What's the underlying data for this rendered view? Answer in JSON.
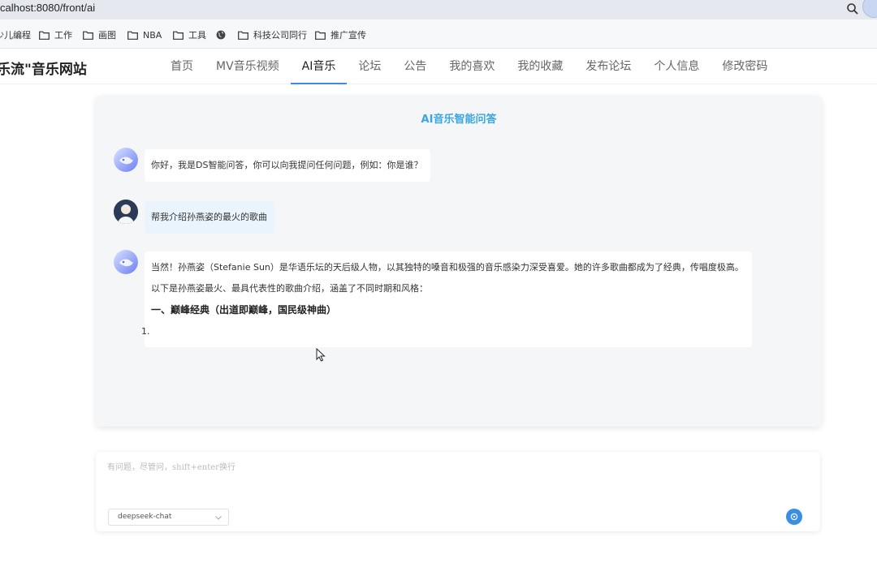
{
  "browser": {
    "url": "calhost:8080/front/ai",
    "bookmarks": [
      {
        "label": "少儿编程",
        "icon": "folder-icon"
      },
      {
        "label": "工作",
        "icon": "folder-icon"
      },
      {
        "label": "画图",
        "icon": "folder-icon"
      },
      {
        "label": "NBA",
        "icon": "folder-icon"
      },
      {
        "label": "工具",
        "icon": "folder-icon"
      },
      {
        "label": "",
        "icon": "globe-icon"
      },
      {
        "label": "科技公司同行",
        "icon": "folder-icon"
      },
      {
        "label": "推广宣传",
        "icon": "folder-icon"
      }
    ]
  },
  "site": {
    "brand": "乐流\"音乐网站",
    "nav": [
      {
        "label": "首页",
        "active": false
      },
      {
        "label": "MV音乐视频",
        "active": false
      },
      {
        "label": "AI音乐",
        "active": true
      },
      {
        "label": "论坛",
        "active": false
      },
      {
        "label": "公告",
        "active": false
      },
      {
        "label": "我的喜欢",
        "active": false
      },
      {
        "label": "我的收藏",
        "active": false
      },
      {
        "label": "发布论坛",
        "active": false
      },
      {
        "label": "个人信息",
        "active": false
      },
      {
        "label": "修改密码",
        "active": false
      }
    ]
  },
  "chat": {
    "title": "AI音乐智能问答",
    "messages": [
      {
        "role": "assistant",
        "text": "你好，我是DS智能问答，你可以向我提问任何问题，例如：你是谁？"
      },
      {
        "role": "user",
        "text": "帮我介绍孙燕姿的最火的歌曲"
      },
      {
        "role": "assistant",
        "lines": [
          "当然！孙燕姿（Stefanie Sun）是华语乐坛的天后级人物，以其独特的嗓音和极强的音乐感染力深受喜爱。她的许多歌曲都成为了经典，传唱度极高。",
          "以下是孙燕姿最火、最具代表性的歌曲介绍，涵盖了不同时期和风格："
        ],
        "heading": "一、巅峰经典（出道即巅峰，国民级神曲）",
        "list_marker": "1."
      }
    ]
  },
  "input": {
    "placeholder": "有问题，尽管问，shift+enter换行",
    "model": "deepseek-chat"
  },
  "colors": {
    "accent": "#3a8ee6",
    "title": "#39a6e0",
    "user_bubble": "#e9f4fd"
  }
}
